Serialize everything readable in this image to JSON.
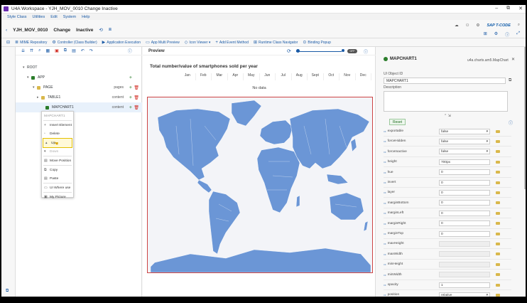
{
  "window": {
    "title": "U4A Workspace - YJH_MOV_0010 Change Inactive",
    "controls": [
      "–",
      "⧉",
      "✕"
    ]
  },
  "menu": [
    "Style Class",
    "Utilities",
    "Edit",
    "System",
    "Help"
  ],
  "header": {
    "back": "‹",
    "app_id": "YJH_MOV_0010",
    "mode": "Change",
    "status": "Inactive",
    "tcode": "SAP T-CODE"
  },
  "toolbar": [
    {
      "icon": "≣",
      "label": "MIME Repository"
    },
    {
      "icon": "⚙",
      "label": "Controller (Class Builder)"
    },
    {
      "icon": "▶",
      "label": "Application Execution"
    },
    {
      "icon": "▭",
      "label": "App Multi Preview"
    },
    {
      "icon": "◇",
      "label": "Icon Viewer ▾"
    },
    {
      "icon": "+",
      "label": "Add Event Method"
    },
    {
      "icon": "⊞",
      "label": "Runtime Class Navigator"
    },
    {
      "icon": "⊙",
      "label": "Binding Popup"
    }
  ],
  "tree": {
    "rows": [
      {
        "label": "ROOT",
        "indent": 10,
        "exp": "▾",
        "aggr": "",
        "color": ""
      },
      {
        "label": "APP",
        "indent": 16,
        "exp": "▾",
        "aggr": "",
        "color": "#2b7d2b"
      },
      {
        "label": "PAGE",
        "indent": 24,
        "exp": "▾",
        "aggr": "pages",
        "color": "#d9b84b"
      },
      {
        "label": "TABLE1",
        "indent": 30,
        "exp": "▸",
        "aggr": "content",
        "color": "#d9b84b"
      },
      {
        "label": "MAPCHART1",
        "indent": 36,
        "exp": "",
        "aggr": "content",
        "color": "#2b7d2b"
      }
    ]
  },
  "context_menu": {
    "header": "MAPCHART1",
    "items": [
      "Insert Element",
      "Delete",
      "Up",
      "Down",
      "Move Position",
      "Copy",
      "Paste",
      "UI Where use",
      "My Picture"
    ]
  },
  "preview": {
    "label": "Preview",
    "toggle": "OFF",
    "no_data": "No data"
  },
  "chart_data": {
    "type": "table",
    "title": "Total number/value of smartphones sold per year",
    "columns": [
      "Jan",
      "Feb",
      "Mar",
      "Apr",
      "May",
      "Jun",
      "Jul",
      "Aug",
      "Sept",
      "Oct",
      "Nov",
      "Dec"
    ],
    "rows": []
  },
  "properties": {
    "object": "MAPCHART1",
    "namespace": "u4a.charts.am5.MapChart",
    "ui_object_id_label": "UI Object ID",
    "ui_object_id": "MAPCHART1",
    "description_label": "Description",
    "reset_label": "Reset",
    "rows": [
      {
        "name": "exportable",
        "value": "false",
        "dropdown": true
      },
      {
        "name": "forceHidden",
        "value": "false",
        "dropdown": true
      },
      {
        "name": "forceInactive",
        "value": "false",
        "dropdown": true
      },
      {
        "name": "height",
        "value": "700px",
        "dropdown": false
      },
      {
        "name": "hue",
        "value": "0",
        "dropdown": false
      },
      {
        "name": "invert",
        "value": "0",
        "dropdown": false
      },
      {
        "name": "layer",
        "value": "0",
        "dropdown": false
      },
      {
        "name": "marginBottom",
        "value": "0",
        "dropdown": false
      },
      {
        "name": "marginLeft",
        "value": "0",
        "dropdown": false
      },
      {
        "name": "marginRight",
        "value": "0",
        "dropdown": false
      },
      {
        "name": "marginTop",
        "value": "0",
        "dropdown": false
      },
      {
        "name": "maxHeight",
        "value": "",
        "dropdown": false
      },
      {
        "name": "maxWidth",
        "value": "",
        "dropdown": false
      },
      {
        "name": "minHeight",
        "value": "",
        "dropdown": false
      },
      {
        "name": "minWidth",
        "value": "",
        "dropdown": false
      },
      {
        "name": "opacity",
        "value": "1",
        "dropdown": false
      },
      {
        "name": "position",
        "value": "relative",
        "dropdown": true
      }
    ]
  },
  "colors": {
    "accent": "#1a5aa6",
    "map_land": "#6b96d6",
    "map_border": "#cc4444"
  }
}
